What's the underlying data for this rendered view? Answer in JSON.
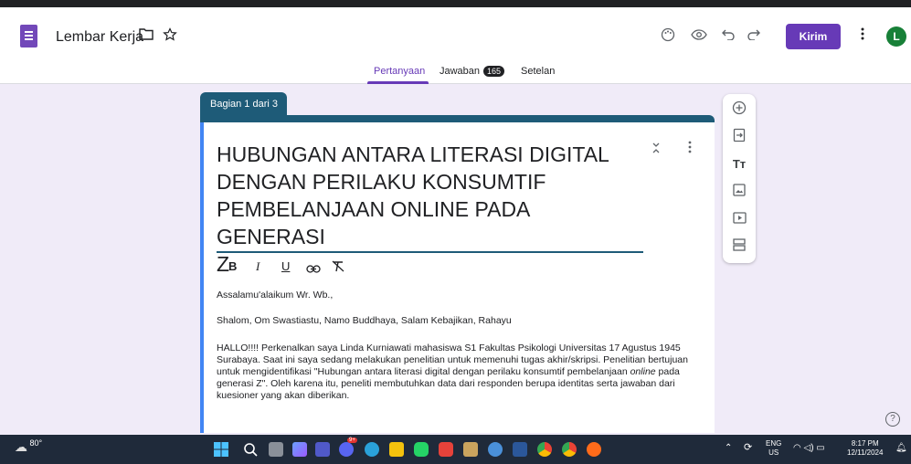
{
  "app": {
    "title": "Lembar Kerja",
    "send_label": "Kirim",
    "avatar_letter": "L",
    "accent": "#673ab7"
  },
  "tabs": [
    {
      "label": "Pertanyaan",
      "active": true
    },
    {
      "label": "Jawaban",
      "count": "165"
    },
    {
      "label": "Setelan"
    }
  ],
  "section": {
    "label": "Bagian 1 dari 3",
    "color": "#1e5b78"
  },
  "form": {
    "title_lines": [
      "HUBUNGAN ANTARA LITERASI DIGITAL",
      "DENGAN PERILAKU KONSUMTIF",
      "PEMBELANJAAN ONLINE PADA GENERASI",
      "Z"
    ],
    "greeting": "Assalamu'alaikum Wr. Wb.,",
    "salam": "Shalom, Om Swastiastu, Namo Buddhaya, Salam Kebajikan, Rahayu",
    "desc_1": "HALLO!!!! Perkenalkan saya Linda Kurniawati mahasiswa S1 Fakultas Psikologi Universitas 17 Agustus 1945 Surabaya. Saat ini saya sedang melakukan penelitian untuk memenuhi tugas akhir/skripsi. Penelitian bertujuan untuk mengidentifikasi \"Hubungan antara literasi digital dengan perilaku konsumtif pembelanjaan ",
    "desc_italic": "online",
    "desc_2": " pada generasi Z\". Oleh karena itu, peneliti membutuhkan data dari responden berupa identitas serta jawaban dari kuesioner yang akan diberikan."
  },
  "format_toolbar": {
    "bold": "B",
    "italic": "I",
    "underline": "U",
    "link_icon": "link-icon",
    "clear_icon": "clear-format-icon"
  },
  "sidebar_icons": [
    "add-question-icon",
    "import-icon",
    "title-icon",
    "image-icon",
    "video-icon",
    "section-icon"
  ],
  "taskbar": {
    "temp": "80°",
    "lang": "ENG",
    "region": "US",
    "time": "8:17 PM",
    "date": "12/11/2024",
    "teams_badge": "9+"
  }
}
